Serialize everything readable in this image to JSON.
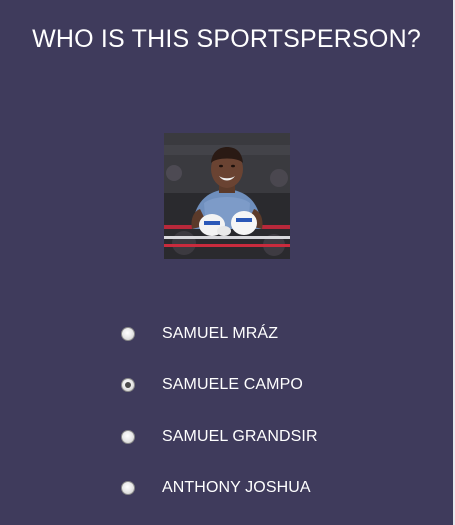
{
  "quiz": {
    "title": "WHO IS THIS SPORTSPERSON?",
    "photo_subject": "boxer portrait",
    "options": [
      {
        "label": "SAMUEL MRÁZ",
        "selected": false
      },
      {
        "label": "SAMUELE CAMPO",
        "selected": true
      },
      {
        "label": "SAMUEL GRANDSIR",
        "selected": false
      },
      {
        "label": "ANTHONY JOSHUA",
        "selected": false
      }
    ]
  },
  "colors": {
    "background": "#3f3b5c",
    "text": "#ffffff"
  }
}
